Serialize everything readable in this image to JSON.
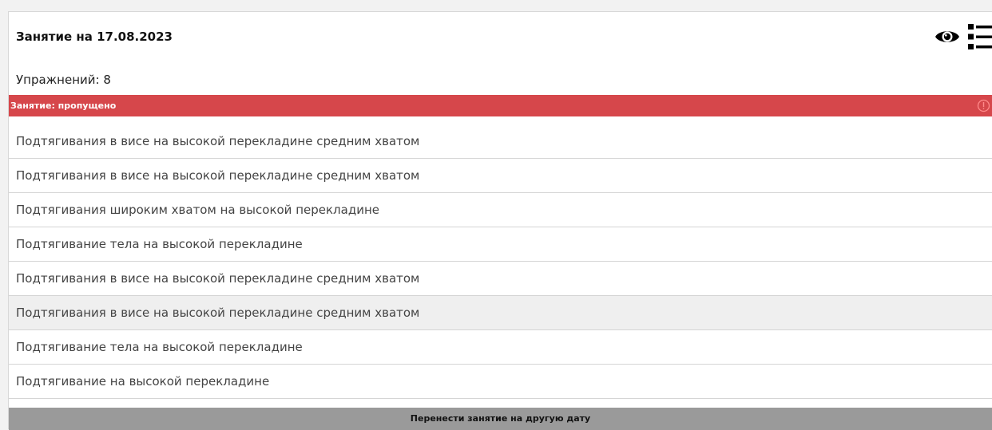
{
  "header": {
    "title": "Занятие на 17.08.2023",
    "eye_icon": "eye-icon",
    "list_icon": "list-icon"
  },
  "summary": {
    "exercise_count": "Упражнений: 8"
  },
  "status": {
    "label": "Занятие: пропущено",
    "color": "#d6474b",
    "icon": "alert-circle-icon"
  },
  "exercises": [
    "Подтягивания в висе на высокой перекладине средним хватом",
    "Подтягивания в висе на высокой перекладине средним хватом",
    "Подтягивания широким хватом на высокой перекладине",
    "Подтягивание тела на высокой перекладине",
    "Подтягивания в висе на высокой перекладине средним хватом",
    "Подтягивания в висе на высокой перекладине средним хватом",
    "Подтягивание тела на высокой перекладине",
    "Подтягивание на высокой перекладине"
  ],
  "footer": {
    "reschedule_label": "Перенести занятие на другую дату"
  }
}
